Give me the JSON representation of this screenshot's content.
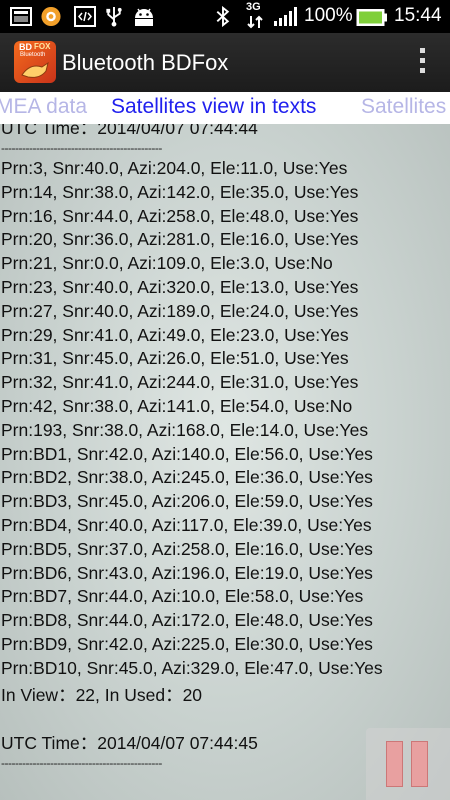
{
  "status_bar": {
    "icons": [
      "image-icon",
      "orange-circle-icon",
      "code-icon",
      "usb-icon",
      "android-icon",
      "bluetooth-icon",
      "network-3g-icon",
      "signal-icon",
      "battery-icon"
    ],
    "network": "3G",
    "battery": "100%",
    "time": "15:44"
  },
  "action_bar": {
    "title": "Bluetooth BDFox",
    "icon_text_top": "BD",
    "icon_text_mid": "FOX",
    "icon_text_bottom": "Bluetooth"
  },
  "tabs": {
    "prev": "MEA data",
    "active": "Satellites view in texts",
    "next": "Satellites"
  },
  "log": {
    "utc_header_top": "UTC Time：2014/04/07 07:44:44",
    "separator": "----------------------------------------------",
    "satellites": [
      "Prn:3, Snr:40.0, Azi:204.0, Ele:11.0, Use:Yes",
      "Prn:14, Snr:38.0, Azi:142.0, Ele:35.0, Use:Yes",
      "Prn:16, Snr:44.0, Azi:258.0, Ele:48.0, Use:Yes",
      "Prn:20, Snr:36.0, Azi:281.0, Ele:16.0, Use:Yes",
      "Prn:21, Snr:0.0, Azi:109.0, Ele:3.0, Use:No",
      "Prn:23, Snr:40.0, Azi:320.0, Ele:13.0, Use:Yes",
      "Prn:27, Snr:40.0, Azi:189.0, Ele:24.0, Use:Yes",
      "Prn:29, Snr:41.0, Azi:49.0, Ele:23.0, Use:Yes",
      "Prn:31, Snr:45.0, Azi:26.0, Ele:51.0, Use:Yes",
      "Prn:32, Snr:41.0, Azi:244.0, Ele:31.0, Use:Yes",
      "Prn:42, Snr:38.0, Azi:141.0, Ele:54.0, Use:No",
      "Prn:193, Snr:38.0, Azi:168.0, Ele:14.0, Use:Yes",
      "Prn:BD1, Snr:42.0, Azi:140.0, Ele:56.0, Use:Yes",
      "Prn:BD2, Snr:38.0, Azi:245.0, Ele:36.0, Use:Yes",
      "Prn:BD3, Snr:45.0, Azi:206.0, Ele:59.0, Use:Yes",
      "Prn:BD4, Snr:40.0, Azi:117.0, Ele:39.0, Use:Yes",
      "Prn:BD5, Snr:37.0, Azi:258.0, Ele:16.0, Use:Yes",
      "Prn:BD6, Snr:43.0, Azi:196.0, Ele:19.0, Use:Yes",
      "Prn:BD7, Snr:44.0, Azi:10.0, Ele:58.0, Use:Yes",
      "Prn:BD8, Snr:44.0, Azi:172.0, Ele:48.0, Use:Yes",
      "Prn:BD9, Snr:42.0, Azi:225.0, Ele:30.0, Use:Yes",
      "Prn:BD10, Snr:45.0, Azi:329.0, Ele:47.0, Use:Yes"
    ],
    "summary": "In View：22,   In Used：20",
    "utc_header_bottom": "UTC Time：2014/04/07 07:44:45"
  },
  "colors": {
    "tab_active": "#2020ee",
    "tab_inactive": "#b6b6e6",
    "content_bg": "#d3dbd8",
    "pause_bars": "#e8a0a0"
  }
}
